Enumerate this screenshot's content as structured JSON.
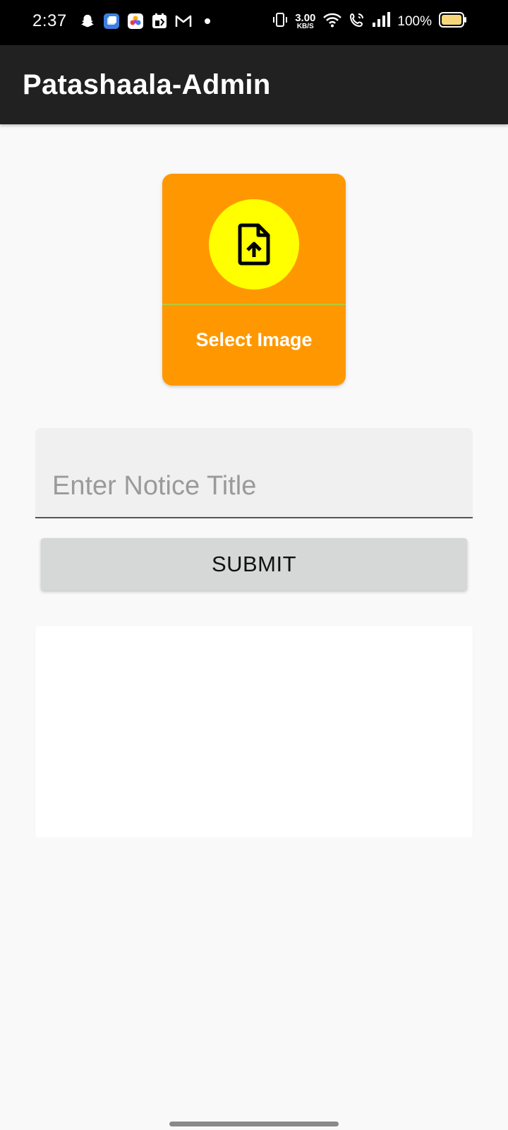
{
  "status_bar": {
    "time": "2:37",
    "notification_icons": [
      "snapchat-icon",
      "blue-app-icon",
      "photos-icon",
      "calendar-icon",
      "gmail-icon"
    ],
    "network_speed_value": "3.00",
    "network_speed_unit": "KB/S",
    "battery_percent": "100%"
  },
  "app_bar": {
    "title": "Patashaala-Admin"
  },
  "select_image": {
    "label": "Select Image",
    "icon": "file-upload-icon"
  },
  "notice_title": {
    "value": "",
    "placeholder": "Enter Notice Title"
  },
  "submit": {
    "label": "SUBMIT"
  },
  "colors": {
    "app_bar": "#212121",
    "card": "#ff9800",
    "upload_circle": "#ffff00",
    "submit_button": "#d6d7d7",
    "background": "#f9f9f9"
  }
}
